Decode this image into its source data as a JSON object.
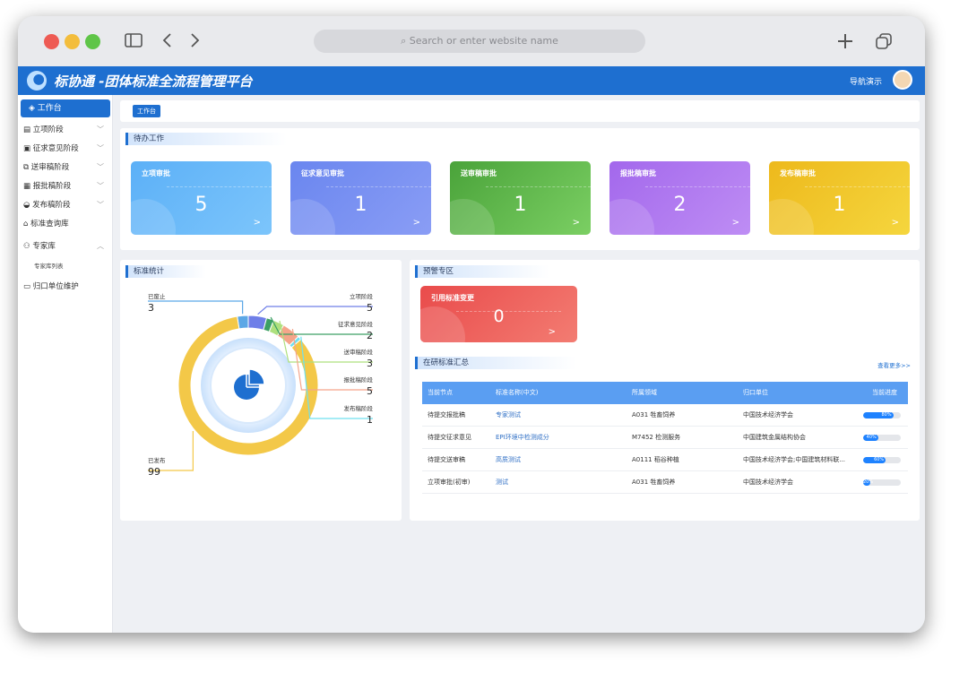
{
  "browser": {
    "url_placeholder": "Search or enter website name"
  },
  "header": {
    "title": "标协通 -团体标准全流程管理平台",
    "nav_demo": "导航演示"
  },
  "sidebar": {
    "active": "工作台",
    "items": [
      {
        "label": "立项阶段",
        "icon": "doc-icon",
        "has_chevron": true
      },
      {
        "label": "征求意见阶段",
        "icon": "print-icon",
        "has_chevron": true
      },
      {
        "label": "送审稿阶段",
        "icon": "send-icon",
        "has_chevron": true
      },
      {
        "label": "报批稿阶段",
        "icon": "list-icon",
        "has_chevron": true
      },
      {
        "label": "发布稿阶段",
        "icon": "cloud-icon",
        "has_chevron": true
      },
      {
        "label": "标准查询库",
        "icon": "home-icon",
        "has_chevron": false
      },
      {
        "label": "专家库",
        "icon": "people-icon",
        "has_chevron": true,
        "expanded": true
      },
      {
        "label": "归口单位维护",
        "icon": "monitor-icon",
        "has_chevron": false
      }
    ],
    "sub_items": [
      "专家库列表"
    ]
  },
  "breadcrumb": "工作台",
  "todo": {
    "title": "待办工作",
    "tiles": [
      {
        "label": "立项审批",
        "count": "5"
      },
      {
        "label": "征求意见审批",
        "count": "1"
      },
      {
        "label": "送审稿审批",
        "count": "1"
      },
      {
        "label": "报批稿审批",
        "count": "2"
      },
      {
        "label": "发布稿审批",
        "count": "1"
      }
    ],
    "arrow": ">"
  },
  "stats": {
    "title": "标准统计",
    "chart_data": {
      "type": "pie",
      "categories": [
        "已废止",
        "立项阶段",
        "征求意见阶段",
        "送审稿阶段",
        "报批稿阶段",
        "发布稿阶段",
        "已发布"
      ],
      "values": [
        3,
        5,
        2,
        3,
        5,
        1,
        99
      ],
      "colors": [
        "#5ba7e6",
        "#6f7fe8",
        "#3c9f63",
        "#aee07e",
        "#f5a58a",
        "#6fe0ef",
        "#f3c848"
      ]
    }
  },
  "warning": {
    "title": "预警专区",
    "tile": {
      "label": "引用标准变更",
      "count": "0"
    }
  },
  "summary": {
    "title": "在研标准汇总",
    "more_link": "查看更多>>",
    "columns": [
      "当前节点",
      "标准名称(中文)",
      "所属领域",
      "归口单位",
      "当前进度"
    ],
    "rows": [
      {
        "node": "待提交报批稿",
        "name": "专家测试",
        "field": "A031 牲畜饲养",
        "unit": "中国技术经济学会",
        "progress": 80,
        "progress_label": "80%"
      },
      {
        "node": "待提交征求意见",
        "name": "EPI环境中检测成分",
        "field": "M7452 检测服务",
        "unit": "中国建筑金属结构协会",
        "progress": 40,
        "progress_label": "40%"
      },
      {
        "node": "待提交送审稿",
        "name": "高质测试",
        "field": "A0111 稻谷种植",
        "unit": "中国技术经济学会;中国建筑材料联...",
        "progress": 60,
        "progress_label": "60%"
      },
      {
        "node": "立项审批(初审)",
        "name": "测试",
        "field": "A031 牲畜饲养",
        "unit": "中国技术经济学会",
        "progress": 20,
        "progress_label": "20%"
      }
    ]
  }
}
